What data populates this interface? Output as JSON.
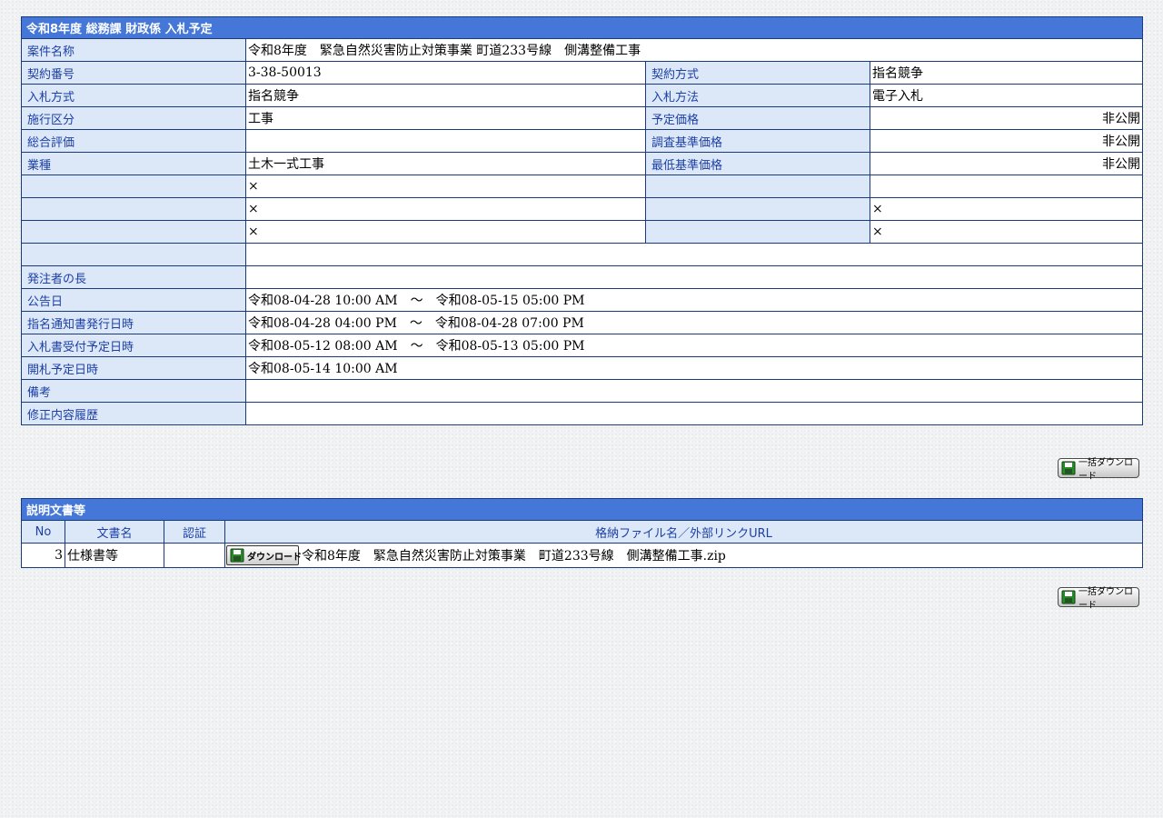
{
  "main": {
    "title": "令和8年度 総務課 財政係 入札予定",
    "project_name_label": "案件名称",
    "project_name": "令和8年度　緊急自然災害防止対策事業 町道233号線　側溝整備工事",
    "contract_no_label": "契約番号",
    "contract_no": "3-38-50013",
    "contract_method_label": "契約方式",
    "contract_method": "指名競争",
    "bid_style_label": "入札方式",
    "bid_style": "指名競争",
    "bid_method_label": "入札方法",
    "bid_method": "電子入札",
    "category_label": "施行区分",
    "category": "工事",
    "planned_price_label": "予定価格",
    "planned_price": "非公開",
    "overall_eval_label": "総合評価",
    "overall_eval": "",
    "survey_price_label": "調査基準価格",
    "survey_price": "非公開",
    "industry_label": "業種",
    "industry": "土木一式工事",
    "min_price_label": "最低基準価格",
    "min_price": "非公開",
    "blank_row1_val": "×",
    "blank_row2_val": "×",
    "blank_row2_val2": "×",
    "blank_row3_val": "×",
    "blank_row3_val2": "×",
    "orderer_head_label": "発注者の長",
    "orderer_head": "",
    "announce_label": "公告日",
    "announce": "令和08-04-28 10:00 AM　～　令和08-05-15 05:00 PM",
    "nomination_label": "指名通知書発行日時",
    "nomination": "令和08-04-28 04:00 PM　～　令和08-04-28 07:00 PM",
    "bid_accept_label": "入札書受付予定日時",
    "bid_accept": "令和08-05-12 08:00 AM　～　令和08-05-13 05:00 PM",
    "opening_label": "開札予定日時",
    "opening": "令和08-05-14 10:00 AM",
    "remarks_label": "備考",
    "remarks": "",
    "history_label": "修正内容履歴",
    "history": ""
  },
  "bulk_download_label": "一括ダウンロード",
  "documents": {
    "title": "説明文書等",
    "col_no": "No",
    "col_name": "文書名",
    "col_auth": "認証",
    "col_file": "格納ファイル名／外部リンクURL",
    "rows": [
      {
        "no": "3",
        "name": "仕様書等",
        "auth": "",
        "download_label": "ダウンロード",
        "file": "令和8年度　緊急自然災害防止対策事業　町道233号線　側溝整備工事.zip"
      }
    ]
  },
  "colors": {
    "title_bar": "#4577d8",
    "label_bg": "#dce8f7",
    "label_text": "#1c3fa6",
    "border": "#1a3a7a"
  },
  "icons": {
    "download": "download-disk-icon"
  }
}
